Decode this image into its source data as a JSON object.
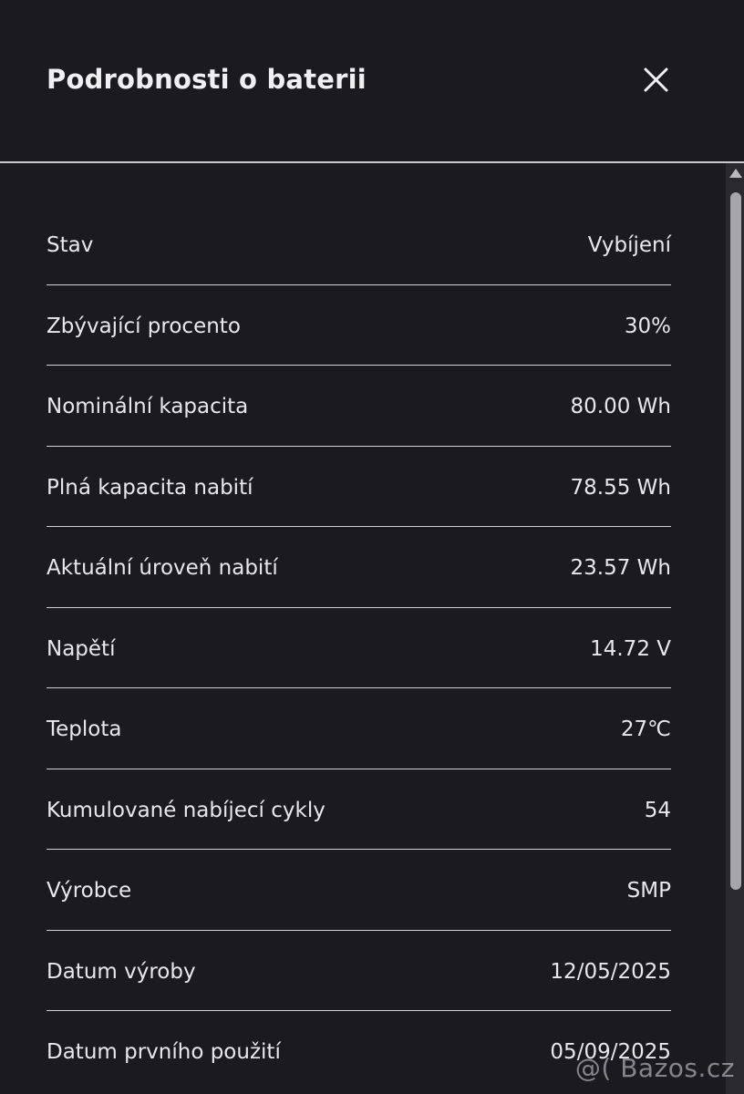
{
  "dialog": {
    "title": "Podrobnosti o baterii",
    "close_icon": "close-icon"
  },
  "battery_details": [
    {
      "label": "Stav",
      "value": "Vybíjení"
    },
    {
      "label": "Zbývající procento",
      "value": "30%"
    },
    {
      "label": "Nominální kapacita",
      "value": "80.00 Wh"
    },
    {
      "label": "Plná kapacita nabití",
      "value": "78.55 Wh"
    },
    {
      "label": "Aktuální úroveň nabití",
      "value": "23.57 Wh"
    },
    {
      "label": "Napětí",
      "value": "14.72 V"
    },
    {
      "label": "Teplota",
      "value": "27℃"
    },
    {
      "label": "Kumulované nabíjecí cykly",
      "value": "54"
    },
    {
      "label": "Výrobce",
      "value": "SMP"
    },
    {
      "label": "Datum výroby",
      "value": "12/05/2025"
    },
    {
      "label": "Datum prvního použití",
      "value": "05/09/2025"
    }
  ],
  "watermark": "@( Bazos.cz",
  "colors": {
    "background": "#1b1a1f",
    "text": "#e8e8ea",
    "divider": "#d2d2d6",
    "scrollbar_thumb": "#a6a6aa"
  }
}
